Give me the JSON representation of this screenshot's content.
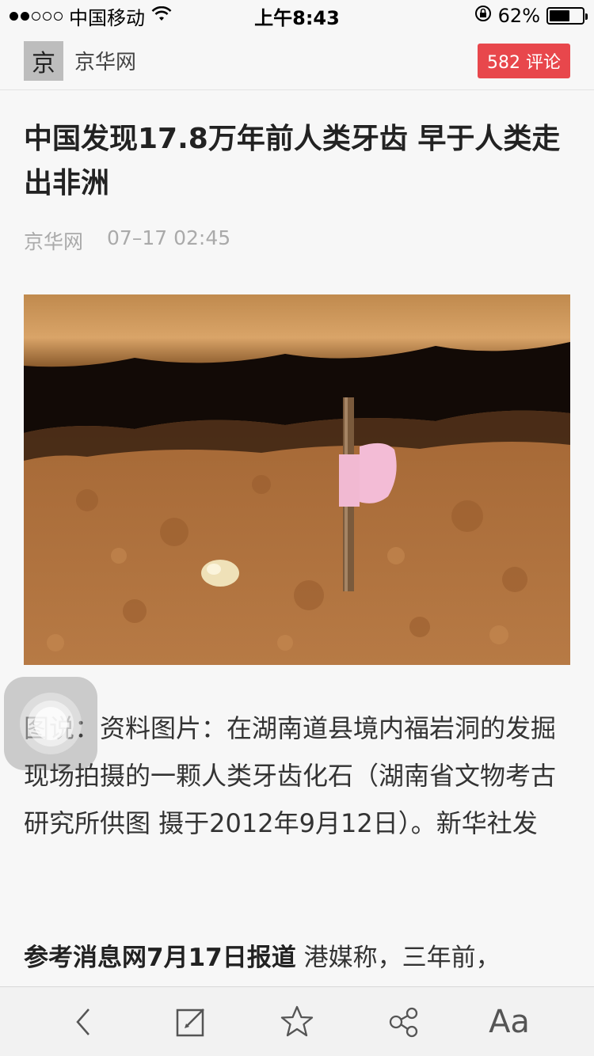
{
  "status_bar": {
    "carrier": "中国移动",
    "time": "上午8:43",
    "battery": "62%",
    "battery_level": 0.62,
    "signal_dots_filled": 2,
    "signal_dots_total": 5
  },
  "header": {
    "logo_char": "京",
    "source_name": "京华网",
    "comment_count": "582 评论"
  },
  "article": {
    "title": "中国发现17.8万年前人类牙齿 早于人类走出非洲",
    "meta_source": "京华网",
    "meta_time": "07–17 02:45",
    "caption": "图说：资料图片：在湖南道县境内福岩洞的发掘现场拍摄的一颗人类牙齿化石（湖南省文物考古研究所供图 摄于2012年9月12日）。新华社发",
    "lead_bold": "参考消息网7月17日报道",
    "lead_text": " 港媒称，三年前，"
  },
  "toolbar": {
    "font_label": "Aa"
  },
  "colors": {
    "accent": "#e8474c",
    "background": "#f7f7f7"
  }
}
